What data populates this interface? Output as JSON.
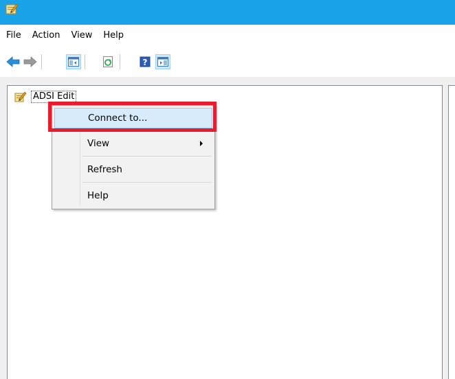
{
  "menubar": {
    "items": [
      "File",
      "Action",
      "View",
      "Help"
    ]
  },
  "toolbar": {
    "buttons": [
      {
        "name": "back",
        "icon": "back-arrow-icon"
      },
      {
        "name": "forward",
        "icon": "forward-arrow-icon"
      },
      {
        "name": "show-hide-console-tree",
        "icon": "console-tree-icon"
      },
      {
        "name": "refresh",
        "icon": "refresh-icon"
      },
      {
        "name": "help",
        "icon": "help-icon"
      },
      {
        "name": "show-hide-action-pane",
        "icon": "action-pane-icon"
      }
    ]
  },
  "tree": {
    "root_label": "ADSI Edit",
    "root_icon": "adsi-edit-icon"
  },
  "context_menu": {
    "items": [
      {
        "label": "Connect to...",
        "highlighted": true
      },
      {
        "label": "View",
        "submenu": true
      },
      {
        "label": "Refresh"
      },
      {
        "label": "Help"
      }
    ]
  },
  "colors": {
    "titlebar": "#1aa3e8",
    "highlight_border": "#e81c2c",
    "menu_hover": "#d7ebfb"
  }
}
